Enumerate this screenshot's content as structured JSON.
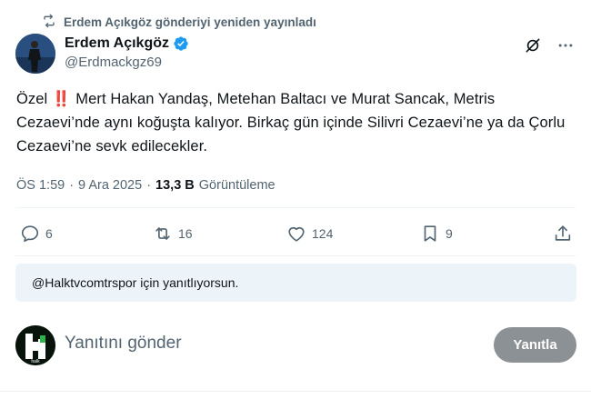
{
  "repost": {
    "icon": "repost-icon",
    "text": "Erdem Açıkgöz gönderiyi yeniden yayınladı"
  },
  "author": {
    "display_name": "Erdem Açıkgöz",
    "handle": "@Erdmackgz69",
    "verified": true,
    "verified_color": "#1d9bf0"
  },
  "header_actions": {
    "grok_icon": "grok-icon",
    "more_icon": "more-icon"
  },
  "tweet": {
    "prefix": "Özel",
    "emoji": "‼️",
    "body": "Mert Hakan Yandaş, Metehan Baltacı ve Murat Sancak, Metris Cezaevi’nde aynı koğuşta kalıyor. Birkaç gün içinde Silivri Cezaevi’ne ya da Çorlu Cezaevi’ne sevk edilecekler."
  },
  "meta": {
    "time": "ÖS 1:59",
    "separator": "·",
    "date": "9 Ara 2025",
    "views": "13,3 B",
    "views_label": "Görüntüleme"
  },
  "actions": {
    "replies": "6",
    "reposts": "16",
    "likes": "124",
    "bookmarks": "9"
  },
  "reply_context": "@Halktvcomtrspor için yanıtlıyorsun.",
  "compose": {
    "placeholder": "Yanıtını gönder",
    "button_label": "Yanıtla",
    "avatar_text": "halk"
  },
  "colors": {
    "text": "#0f1419",
    "secondary": "#536471",
    "divider": "#eff3f4",
    "reply_context_bg": "#edf4f9",
    "button_disabled": "#8c9195"
  }
}
